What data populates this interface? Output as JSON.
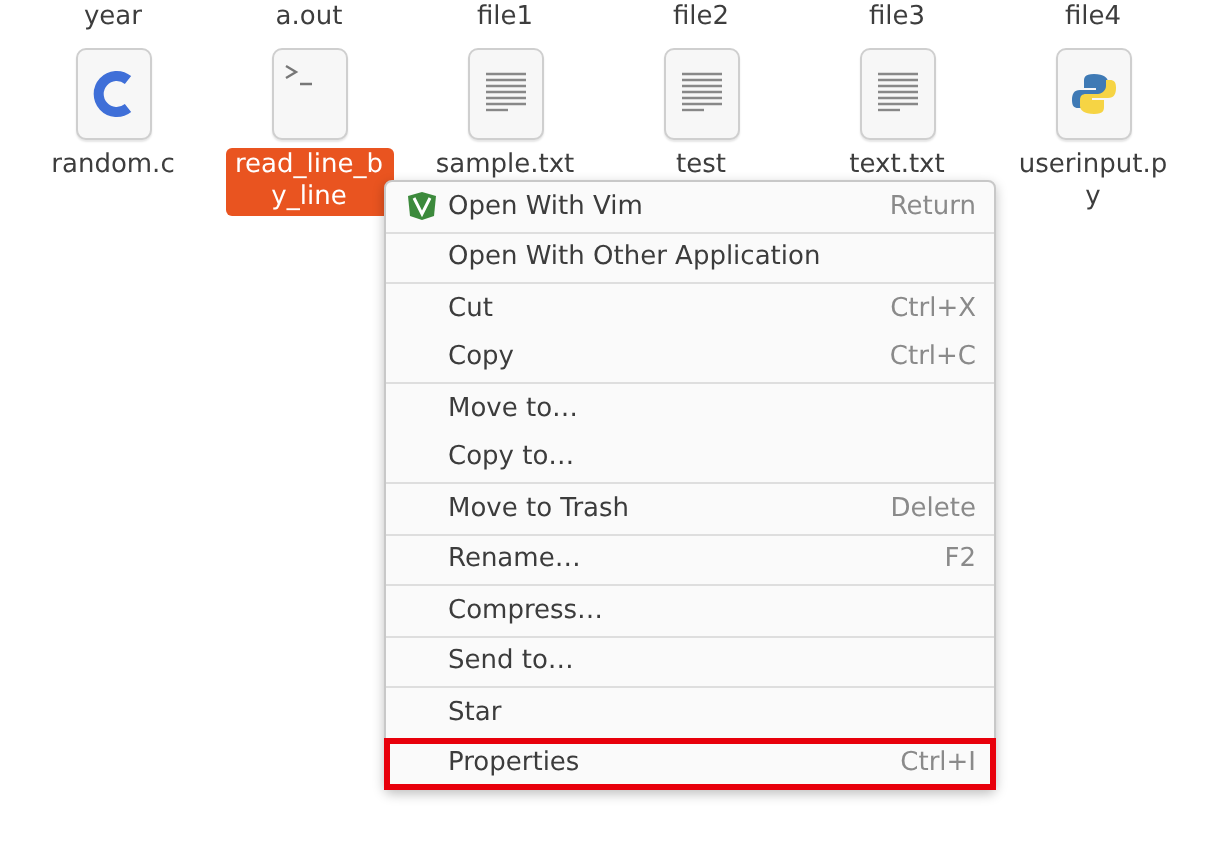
{
  "top_row": [
    "year",
    "a.out",
    "file1",
    "file2",
    "file3",
    "file4"
  ],
  "files": [
    {
      "name": "random.c",
      "kind": "c",
      "selected": false
    },
    {
      "name": "read_line_by_line",
      "kind": "script",
      "selected": true
    },
    {
      "name": "sample.txt",
      "kind": "text",
      "selected": false
    },
    {
      "name": "test",
      "kind": "text",
      "selected": false
    },
    {
      "name": "text.txt",
      "kind": "text",
      "selected": false
    },
    {
      "name": "userinput.py",
      "kind": "python",
      "selected": false
    }
  ],
  "context_menu": {
    "groups": [
      [
        {
          "label": "Open With Vim",
          "shortcut": "Return",
          "kind": "app",
          "highlighted": false
        }
      ],
      [
        {
          "label": "Open With Other Application",
          "highlighted": false
        }
      ],
      [
        {
          "label": "Cut",
          "shortcut": "Ctrl+X",
          "highlighted": false
        },
        {
          "label": "Copy",
          "shortcut": "Ctrl+C",
          "highlighted": false
        }
      ],
      [
        {
          "label": "Move to…",
          "highlighted": false
        },
        {
          "label": "Copy to…",
          "highlighted": false
        }
      ],
      [
        {
          "label": "Move to Trash",
          "shortcut": "Delete",
          "highlighted": false
        }
      ],
      [
        {
          "label": "Rename…",
          "shortcut": "F2",
          "highlighted": false
        }
      ],
      [
        {
          "label": "Compress…",
          "highlighted": false
        }
      ],
      [
        {
          "label": "Send to…",
          "highlighted": false
        }
      ],
      [
        {
          "label": "Star",
          "highlighted": false
        }
      ],
      [
        {
          "label": "Properties",
          "shortcut": "Ctrl+I",
          "highlighted": true
        }
      ]
    ]
  }
}
